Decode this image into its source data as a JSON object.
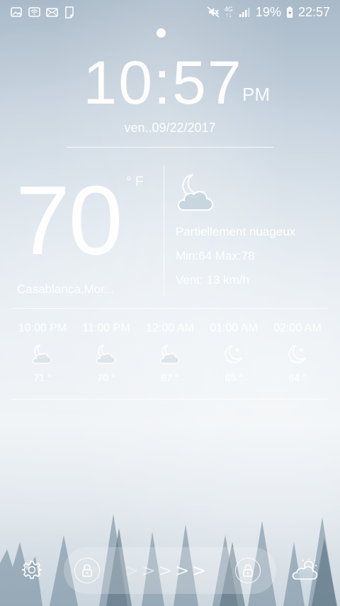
{
  "status_bar": {
    "icons_left": [
      "gallery-icon",
      "wifi-icon",
      "mail-icon",
      "file-icon"
    ],
    "icons_right": [
      "mute-icon",
      "network-4g-icon",
      "signal-icon",
      "charging-icon"
    ],
    "network_label_top": "4G",
    "network_label_bottom": "↑↓",
    "battery": "19%",
    "time": "22:57"
  },
  "clock": {
    "time": "10:57",
    "ampm": "PM",
    "date": "ven..09/22/2017"
  },
  "weather": {
    "temperature": "70",
    "unit": "° F",
    "city": "Casablanca,Mor...",
    "condition_icon": "cloud-moon-icon",
    "condition": "Partiellement nuageux",
    "minmax": "Min:64  Max:78",
    "wind": "Vent:  13 km/h"
  },
  "hourly": [
    {
      "time": "10:00 PM",
      "temp": "71 °",
      "icon": "cloud-moon-icon"
    },
    {
      "time": "11:00 PM",
      "temp": "70 °",
      "icon": "cloud-moon-icon"
    },
    {
      "time": "12:00 AM",
      "temp": "67 °",
      "icon": "cloud-moon-icon"
    },
    {
      "time": "01:00 AM",
      "temp": "65 °",
      "icon": "moon-star-icon"
    },
    {
      "time": "02:00 AM",
      "temp": "64 °",
      "icon": "moon-star-icon"
    }
  ],
  "bottom": {
    "arrows": [
      ">",
      ">",
      ">",
      ">",
      ">"
    ],
    "icons": [
      "settings-gear-icon",
      "lock-icon",
      "unlock-icon",
      "sun-cloud-icon"
    ]
  }
}
